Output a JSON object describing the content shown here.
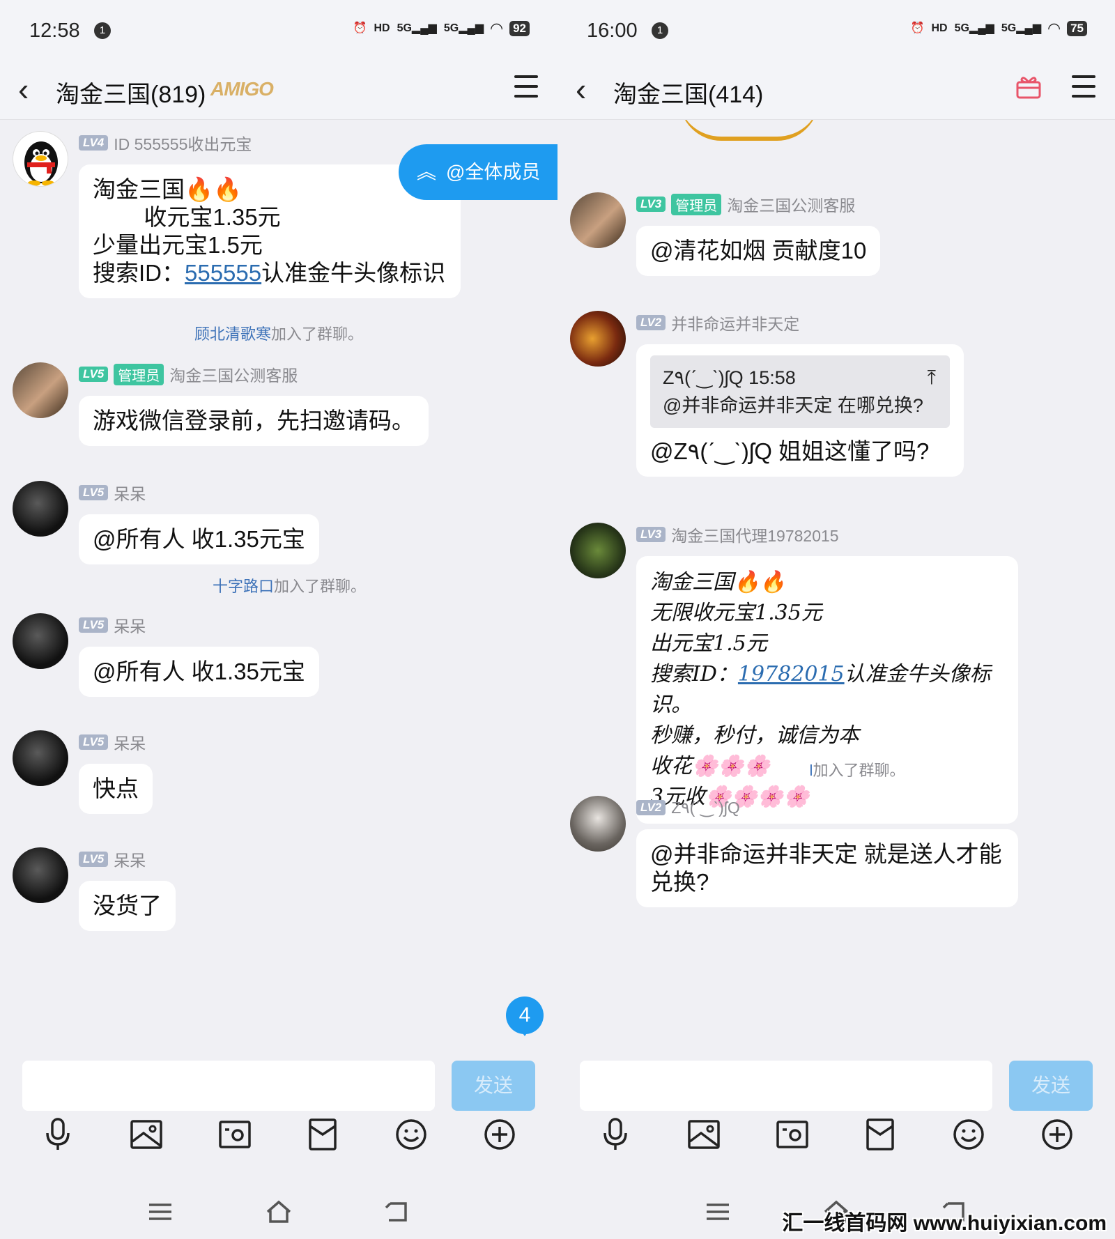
{
  "left": {
    "status": {
      "time": "12:58",
      "notif": "1",
      "battery": "92",
      "hd": "HD",
      "net1": "5G",
      "net2": "5G"
    },
    "title": "淘金三国(819)",
    "title_badge": "AMIGO",
    "at_all": "@全体成员",
    "unread": "4",
    "send": "发送",
    "messages": [
      {
        "level": "LV4",
        "name": "ID  555555收出元宝",
        "lines": [
          "淘金三国🔥🔥",
          "        收元宝1.35元",
          "少量出元宝1.5元"
        ],
        "search_prefix": "搜索ID：",
        "search_id": "555555",
        "search_suffix": "认准金牛头像标识"
      },
      {
        "level": "LV5",
        "admin": "管理员",
        "name": "淘金三国公测客服",
        "text": "游戏微信登录前，先扫邀请码。"
      },
      {
        "level": "LV5",
        "name": "呆呆",
        "text": "@所有人 收1.35元宝"
      },
      {
        "level": "LV5",
        "name": "呆呆",
        "text": "@所有人 收1.35元宝"
      },
      {
        "level": "LV5",
        "name": "呆呆",
        "text": "快点"
      },
      {
        "level": "LV5",
        "name": "呆呆",
        "text": "没货了"
      }
    ],
    "system": [
      {
        "name": "顾北清歌寒",
        "text": "加入了群聊。"
      },
      {
        "name": "十字路口",
        "text": "加入了群聊。"
      }
    ]
  },
  "right": {
    "status": {
      "time": "16:00",
      "notif": "1",
      "battery": "75",
      "hd": "HD",
      "net1": "5G",
      "net2": "5G"
    },
    "title": "淘金三国(414)",
    "send": "发送",
    "messages": [
      {
        "level": "LV3",
        "admin": "管理员",
        "name": "淘金三国公测客服",
        "text": "@清花如烟 贡献度10"
      },
      {
        "level": "LV2",
        "name": "并非命运并非天定",
        "quote_head": "Z٩(ˊ‿ˋ)ʃQ 15:58",
        "quote_body": "@并非命运并非天定 在哪兑换?",
        "text": "@Z٩(ˊ‿ˋ)ʃQ 姐姐这懂了吗?"
      },
      {
        "level": "LV3",
        "name": "淘金三国代理19782015",
        "lines": [
          "淘金三国🔥🔥",
          "无限收元宝1.35元",
          "出元宝1.5元"
        ],
        "search_prefix": "搜索ID：",
        "search_id": "19782015",
        "search_suffix": "认准金牛头像标识。",
        "lines2": [
          "秒赚，秒付，诚信为本",
          "收花🌸🌸🌸",
          "3元收🌸🌸🌸🌸"
        ]
      },
      {
        "level": "LV2",
        "name": "Z٩(ˊ‿ˋ)ʃQ",
        "text": "@并非命运并非天定 就是送人才能兑换?"
      }
    ],
    "system": [
      {
        "name": "l",
        "text": "加入了群聊。"
      }
    ]
  },
  "watermark": "汇一线首码网 www.huiyixian.com",
  "colors": {
    "accent": "#1e9bf0",
    "link": "#2b6cb0",
    "admin": "#3ec5a0",
    "level": "#aab4c8"
  }
}
